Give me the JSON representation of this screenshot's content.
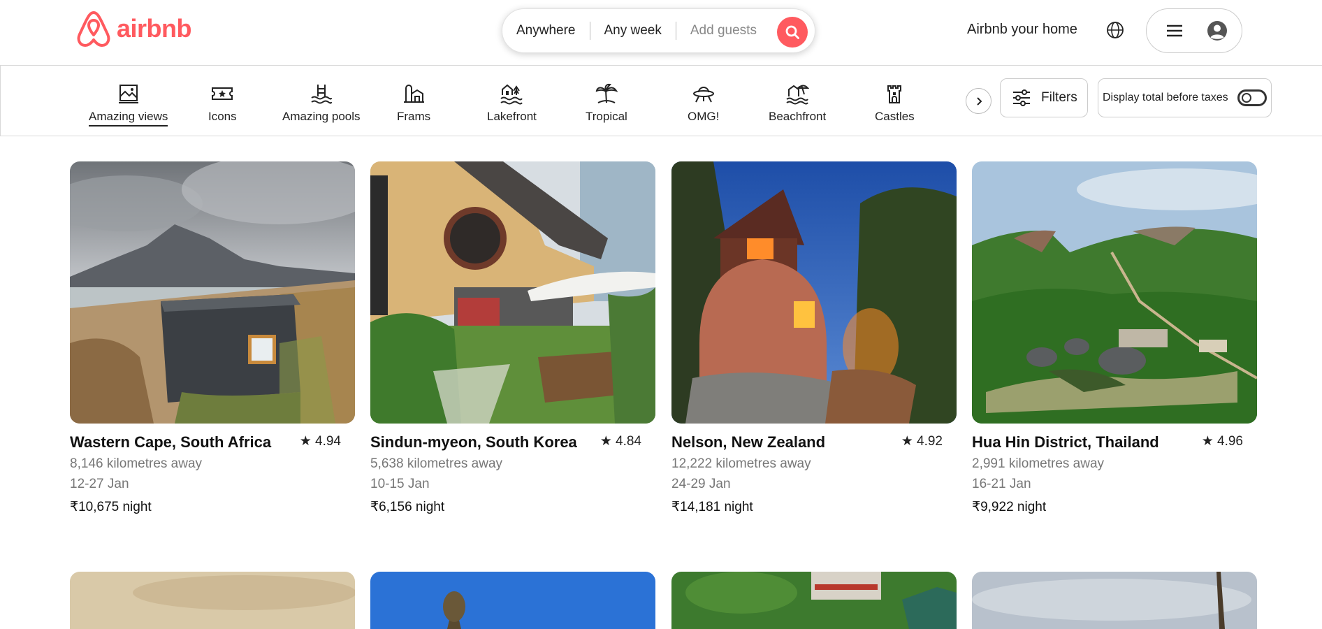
{
  "brand": {
    "name": "airbnb",
    "color": "#ff5a5f"
  },
  "search": {
    "where": "Anywhere",
    "when": "Any week",
    "guests": "Add guests"
  },
  "header": {
    "host_link": "Airbnb your home"
  },
  "categories": [
    {
      "label": "Amazing views",
      "icon": "amazing-views-icon",
      "active": true
    },
    {
      "label": "Icons",
      "icon": "icons-icon"
    },
    {
      "label": "Amazing pools",
      "icon": "pools-icon"
    },
    {
      "label": "Frams",
      "icon": "farms-icon"
    },
    {
      "label": "Lakefront",
      "icon": "lakefront-icon"
    },
    {
      "label": "Tropical",
      "icon": "tropical-icon"
    },
    {
      "label": "OMG!",
      "icon": "ufo-icon"
    },
    {
      "label": "Beachfront",
      "icon": "beachfront-icon"
    },
    {
      "label": "Castles",
      "icon": "castle-icon"
    }
  ],
  "filters": {
    "label": "Filters"
  },
  "taxes": {
    "label": "Display total before taxes",
    "enabled": false
  },
  "listings": [
    {
      "title": "Wastern Cape, South Africa",
      "rating": "★ 4.94",
      "distance": "8,146 kilometres away",
      "dates": "12-27 Jan",
      "price": "₹10,675 night"
    },
    {
      "title": "Sindun-myeon, South Korea",
      "rating": "★ 4.84",
      "distance": "5,638 kilometres away",
      "dates": "10-15 Jan",
      "price": "₹6,156 night"
    },
    {
      "title": "Nelson, New Zealand",
      "rating": "★ 4.92",
      "distance": "12,222 kilometres away",
      "dates": "24-29 Jan",
      "price": "₹14,181 night"
    },
    {
      "title": "Hua Hin District, Thailand",
      "rating": "★ 4.96",
      "distance": "2,991 kilometres away",
      "dates": "16-21 Jan",
      "price": "₹9,922 night"
    }
  ]
}
